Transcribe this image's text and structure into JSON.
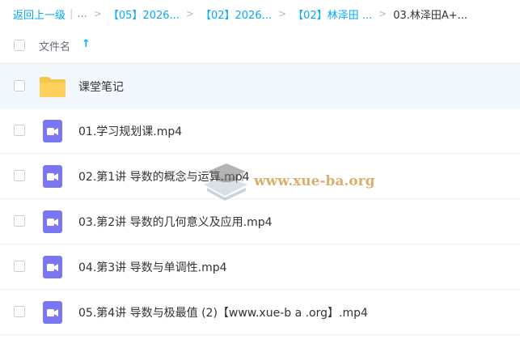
{
  "breadcrumb": {
    "back_label": "返回上一级",
    "overflow": "...",
    "items": [
      "【05】2026...",
      "【02】2026...",
      "【02】林泽田 ..."
    ],
    "current": "03.林泽田A+..."
  },
  "header": {
    "column_label": "文件名",
    "sort_icon": "arrow-up-icon"
  },
  "files": [
    {
      "name": "课堂笔记",
      "icon": "folder-icon"
    },
    {
      "name": "01.学习规划课.mp4",
      "icon": "video-file-icon"
    },
    {
      "name": "02.第1讲 导数的概念与运算.mp4",
      "icon": "video-file-icon"
    },
    {
      "name": "03.第2讲 导数的几何意义及应用.mp4",
      "icon": "video-file-icon"
    },
    {
      "name": "04.第3讲 导数与单调性.mp4",
      "icon": "video-file-icon"
    },
    {
      "name": "05.第4讲 导数与极最值 (2)【www.xue-b a .org】.mp4",
      "icon": "video-file-icon"
    }
  ],
  "watermark": {
    "text": "www.xue-ba.org"
  },
  "colors": {
    "accent": "#06a7ff",
    "folder": "#ffd15c",
    "video": "#7b76f1",
    "selected_row": "#f2f8fd"
  }
}
